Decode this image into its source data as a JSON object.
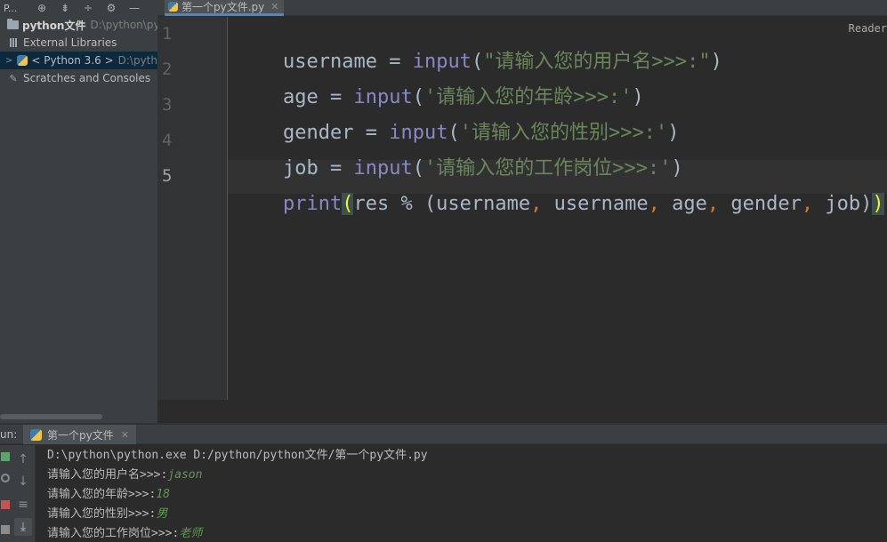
{
  "project_toolbar": {
    "view_label": "P...",
    "icons": [
      "locate-icon",
      "collapse-all-icon",
      "expand-all-icon",
      "gear-icon",
      "minimize-icon"
    ]
  },
  "tree": {
    "items": [
      {
        "label": "python文件",
        "path": "D:\\python\\py",
        "icon": "folder-icon"
      },
      {
        "label": "External Libraries",
        "icon": "libraries-icon"
      },
      {
        "label": "< Python 3.6 >",
        "path": "D:\\pyth",
        "icon": "python-icon"
      },
      {
        "label": "Scratches and Consoles",
        "icon": "scratches-icon"
      }
    ]
  },
  "editor": {
    "tab_label": "第一个py文件.py",
    "reader_mode": "Reader",
    "line_numbers": [
      "1",
      "2",
      "3",
      "4",
      "5"
    ],
    "lines": [
      {
        "var": "username",
        "eq": " = ",
        "fn": "input",
        "open": "(",
        "str": "\"请输入您的用户名>>>:\"",
        "close": ")"
      },
      {
        "var": "age",
        "eq": " = ",
        "fn": "input",
        "open": "(",
        "str": "'请输入您的年龄>>>:'",
        "close": ")"
      },
      {
        "var": "gender",
        "eq": " = ",
        "fn": "input",
        "open": "(",
        "str": "'请输入您的性别>>>:'",
        "close": ")"
      },
      {
        "var": "job",
        "eq": " = ",
        "fn": "input",
        "open": "(",
        "str": "'请输入您的工作岗位>>>:'",
        "close": ")"
      },
      {
        "fn": "print",
        "open": "(",
        "mid": "res % (username",
        "a1": "username",
        "a2": "age",
        "a3": "gender",
        "a4": "job)",
        "comma": ", ",
        "close": ")"
      }
    ]
  },
  "run_panel": {
    "label": "un:",
    "tab_label": "第一个py文件",
    "output": [
      {
        "text": "D:\\python\\python.exe D:/python/python文件/第一个py文件.py",
        "input": ""
      },
      {
        "text": "请输入您的用户名>>>:",
        "input": "jason"
      },
      {
        "text": "请输入您的年龄>>>:",
        "input": "18"
      },
      {
        "text": "请输入您的性别>>>:",
        "input": "男"
      },
      {
        "text": "请输入您的工作岗位>>>:",
        "input": "老师"
      }
    ]
  },
  "colors": {
    "keyword_builtin": "#8888c6",
    "string": "#6a8759",
    "comma": "#cc7832",
    "user_input": "#629755",
    "bracket_highlight": "#ffef28"
  }
}
